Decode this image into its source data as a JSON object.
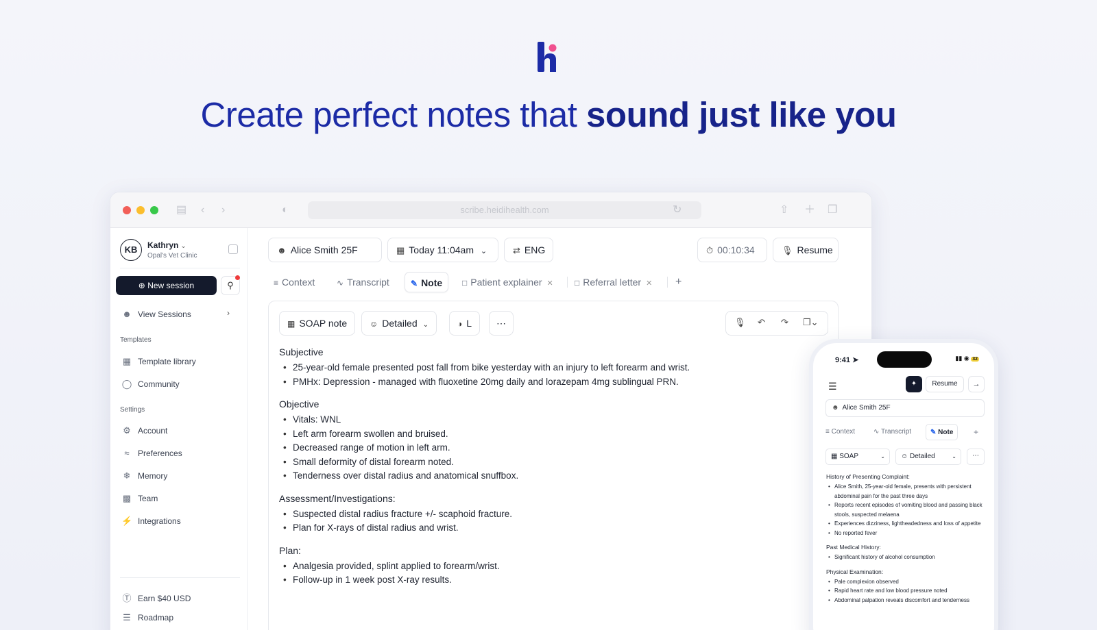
{
  "hero": {
    "headline_regular": "Create perfect notes that ",
    "headline_bold": "sound just like you"
  },
  "browser": {
    "url": "scribe.heidihealth.com"
  },
  "sidebar": {
    "avatar_initials": "KB",
    "user_name": "Kathryn",
    "clinic": "Opal's Vet Clinic",
    "new_session_label": "New session",
    "view_sessions_label": "View Sessions",
    "templates_heading": "Templates",
    "template_library_label": "Template library",
    "community_label": "Community",
    "settings_heading": "Settings",
    "account_label": "Account",
    "preferences_label": "Preferences",
    "memory_label": "Memory",
    "team_label": "Team",
    "integrations_label": "Integrations",
    "earn_label": "Earn $40 USD",
    "roadmap_label": "Roadmap"
  },
  "session": {
    "patient": "Alice Smith 25F",
    "datetime": "Today 11:04am",
    "language": "ENG",
    "timer": "00:10:34",
    "resume_label": "Resume"
  },
  "tabs": {
    "context": "Context",
    "transcript": "Transcript",
    "note": "Note",
    "patient_explainer": "Patient explainer",
    "referral_letter": "Referral letter",
    "add": "+"
  },
  "toolbar": {
    "template": "SOAP note",
    "detail": "Detailed",
    "size": "L",
    "more": "⋯"
  },
  "note": {
    "sections": [
      {
        "heading": "Subjective",
        "items": [
          "25-year-old female presented post fall from bike yesterday with an injury to left forearm and wrist.",
          "PMHx: Depression - managed with fluoxetine 20mg daily and lorazepam 4mg sublingual PRN."
        ]
      },
      {
        "heading": "Objective",
        "items": [
          "Vitals: WNL",
          "Left arm forearm swollen and bruised.",
          "Decreased range of motion in left arm.",
          "Small deformity of distal forearm noted.",
          "Tenderness over distal radius and anatomical snuffbox."
        ]
      },
      {
        "heading": "Assessment/Investigations:",
        "items": [
          "Suspected distal radius fracture +/- scaphoid fracture.",
          "Plan for X-rays of distal radius and wrist."
        ]
      },
      {
        "heading": "Plan:",
        "items": [
          "Analgesia provided, splint applied to forearm/wrist.",
          "Follow-up in 1 week post X-ray results."
        ]
      }
    ]
  },
  "phone": {
    "time": "9:41",
    "battery": "32",
    "resume_label": "Resume",
    "patient": "Alice Smith 25F",
    "tab_context": "Context",
    "tab_transcript": "Transcript",
    "tab_note": "Note",
    "template": "SOAP",
    "detail": "Detailed",
    "more": "⋯",
    "sections": [
      {
        "heading": "History of Presenting Complaint:",
        "items": [
          "Alice Smith, 25-year-old female, presents with persistent abdominal pain for the past three days",
          "Reports recent episodes of vomiting blood and passing black stools, suspected melaena",
          "Experiences dizziness, lightheadedness and loss of appetite",
          "No reported fever"
        ]
      },
      {
        "heading": "Past Medical History:",
        "items": [
          "Significant history of alcohol consumption"
        ]
      },
      {
        "heading": "Physical Examination:",
        "items": [
          "Pale complexion observed",
          "Rapid heart rate and low blood pressure noted",
          "Abdominal palpation reveals discomfort and tenderness"
        ]
      }
    ]
  },
  "colors": {
    "brand_blue": "#1c2ba6",
    "brand_pink": "#f0508f",
    "dark_button": "#141a2c"
  }
}
